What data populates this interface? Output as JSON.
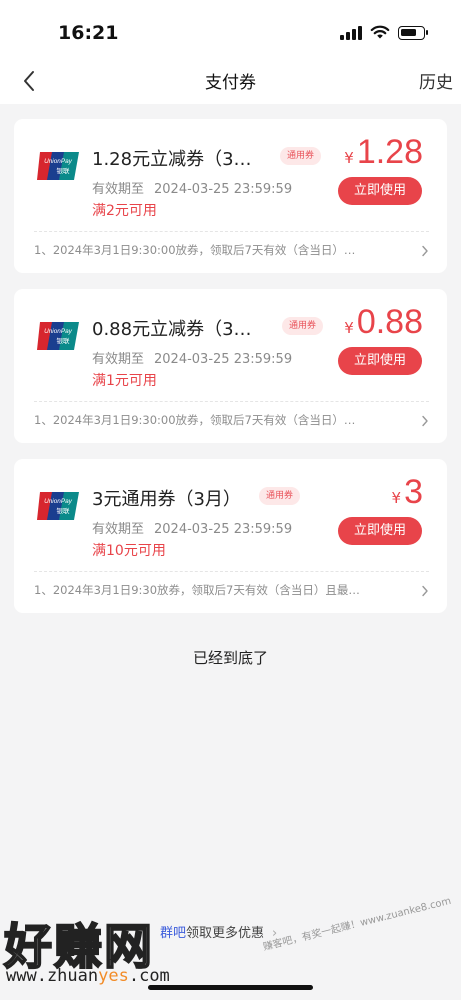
{
  "status_bar": {
    "time": "16:21"
  },
  "nav": {
    "title": "支付券",
    "history": "历史"
  },
  "coupons": [
    {
      "name": "1.28元立减券（3…",
      "tag": "通用券",
      "validity_label": "有效期至",
      "validity_date": "2024-03-25 23:59:59",
      "condition": "满2元可用",
      "currency": "¥",
      "amount": "1.28",
      "button": "立即使用",
      "description": "1、2024年3月1日9:30:00放券，领取后7天有效（含当日）…"
    },
    {
      "name": "0.88元立减券（3…",
      "tag": "通用券",
      "validity_label": "有效期至",
      "validity_date": "2024-03-25 23:59:59",
      "condition": "满1元可用",
      "currency": "¥",
      "amount": "0.88",
      "button": "立即使用",
      "description": "1、2024年3月1日9:30:00放券，领取后7天有效（含当日）…"
    },
    {
      "name": "3元通用券（3月）",
      "tag": "通用券",
      "validity_label": "有效期至",
      "validity_date": "2024-03-25 23:59:59",
      "condition": "满10元可用",
      "currency": "¥",
      "amount": "3",
      "button": "立即使用",
      "description": "1、2024年3月1日9:30放券，领取后7天有效（含当日）且最…"
    }
  ],
  "end_text": "已经到底了",
  "footer": {
    "link_highlight": "群吧",
    "link_text": "领取更多优惠"
  },
  "watermark": {
    "big": "好赚网",
    "url_pre": "www.zhuan",
    "url_hl": "yes",
    "url_post": ".com",
    "right": "赚客吧，有奖一起赚！www.zuanke8.com"
  },
  "colors": {
    "accent": "#e8444a",
    "tag_bg": "#fde8e8",
    "background": "#f4f4f5"
  }
}
